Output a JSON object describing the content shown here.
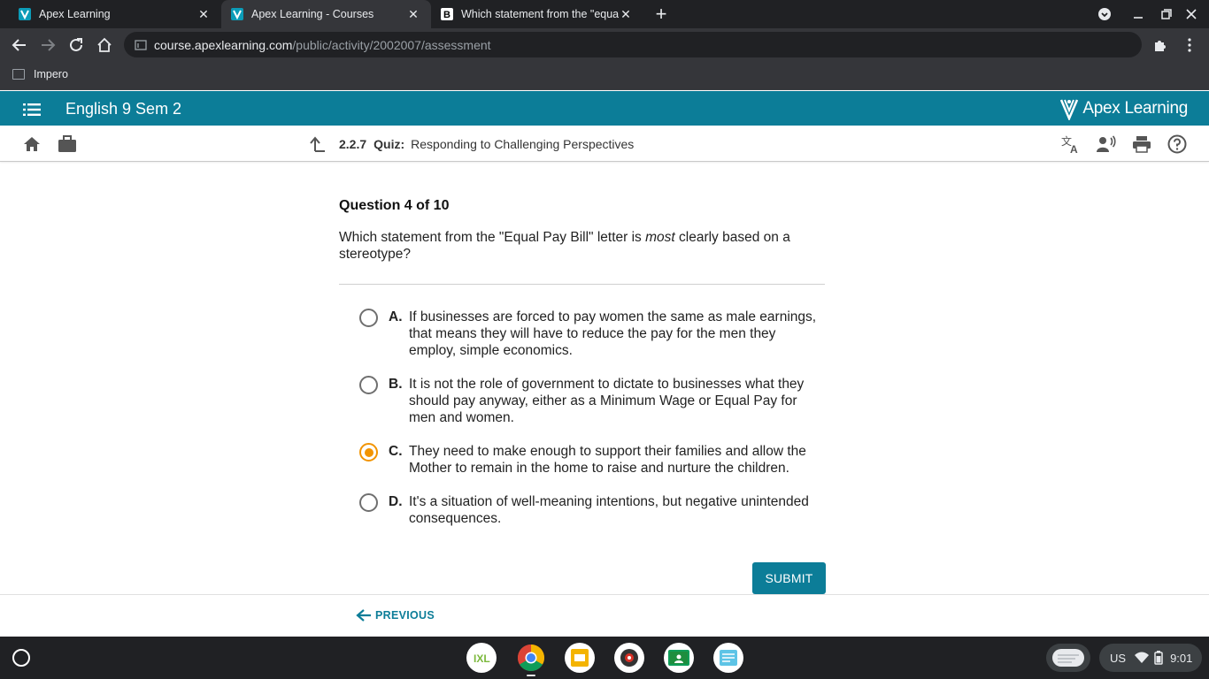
{
  "browser": {
    "tabs": [
      {
        "title": "Apex Learning",
        "active": false
      },
      {
        "title": "Apex Learning - Courses",
        "active": true
      },
      {
        "title": "Which statement from the \"equa",
        "active": false
      }
    ],
    "url_host": "course.apexlearning.com",
    "url_path": "/public/activity/2002007/assessment",
    "bookmarks": [
      {
        "label": "Impero"
      }
    ]
  },
  "apex": {
    "course_title": "English 9 Sem 2",
    "logo_text": "Apex Learning",
    "activity_number": "2.2.7",
    "activity_type": "Quiz:",
    "activity_title": "Responding to Challenging Perspectives"
  },
  "question": {
    "counter": "Question 4 of 10",
    "text_before": "Which statement from the \"Equal Pay Bill\" letter is ",
    "text_emphasis": "most",
    "text_after": " clearly based on a stereotype?",
    "options": [
      {
        "letter": "A.",
        "text": "If businesses are forced to pay women the same as male earnings, that means they will have to reduce the pay for the men they employ, simple economics.",
        "selected": false
      },
      {
        "letter": "B.",
        "text": "It is not the role of government to dictate to businesses what they should pay anyway, either as a Minimum Wage or Equal Pay for men and women.",
        "selected": false
      },
      {
        "letter": "C.",
        "text": "They need to make enough to support their families and allow the Mother to remain in the home to raise and nurture the children.",
        "selected": true
      },
      {
        "letter": "D.",
        "text": "It's a situation of well-meaning intentions, but negative unintended consequences.",
        "selected": false
      }
    ],
    "submit_label": "SUBMIT",
    "previous_label": "PREVIOUS"
  },
  "shelf": {
    "apps": [
      "ixl-icon",
      "chrome-icon",
      "slides-icon",
      "screencast-icon",
      "classroom-icon",
      "kami-icon"
    ],
    "locale": "US",
    "time": "9:01"
  },
  "colors": {
    "apex_teal": "#0c7d98",
    "radio_selected": "#f29400",
    "chrome_dark": "#202124",
    "chrome_toolbar": "#35363a"
  }
}
